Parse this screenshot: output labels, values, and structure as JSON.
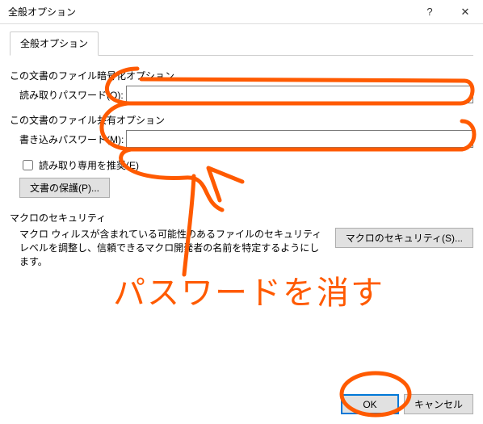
{
  "window": {
    "title": "全般オプション",
    "help_glyph": "?",
    "close_glyph": "✕"
  },
  "tab": {
    "label": "全般オプション"
  },
  "encrypt": {
    "section": "この文書のファイル暗号化オプション",
    "read_label": "読み取りパスワード(O):",
    "read_value": ""
  },
  "share": {
    "section": "この文書のファイル共有オプション",
    "write_label": "書き込みパスワード(M):",
    "write_value": ""
  },
  "readonly_checkbox": "読み取り専用を推奨(E)",
  "protect_button": "文書の保護(P)...",
  "macro": {
    "section": "マクロのセキュリティ",
    "desc": "マクロ ウィルスが含まれている可能性のあるファイルのセキュリティ レベルを調整し、信頼できるマクロ開発者の名前を特定するようにします。",
    "button": "マクロのセキュリティ(S)..."
  },
  "footer": {
    "ok": "OK",
    "cancel": "キャンセル"
  },
  "annotation": {
    "text": "パスワードを消す"
  },
  "colors": {
    "accent": "#ff5a00"
  }
}
